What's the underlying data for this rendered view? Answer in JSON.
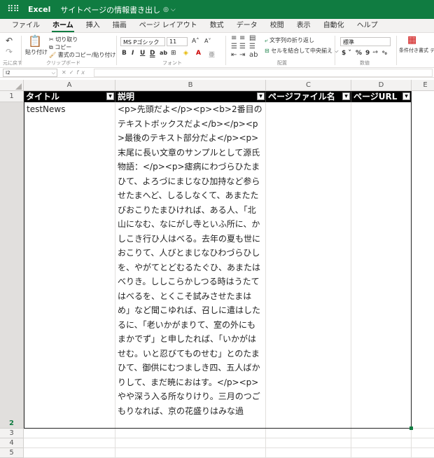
{
  "titlebar": {
    "app_name": "Excel",
    "doc_name": "サイトページの情報書き出し",
    "doc_suffix": "◎ ⌵"
  },
  "menu": {
    "tabs": [
      "ファイル",
      "ホーム",
      "挿入",
      "描画",
      "ページ レイアウト",
      "数式",
      "データ",
      "校閲",
      "表示",
      "自動化",
      "ヘルプ"
    ],
    "active": "ホーム"
  },
  "ribbon": {
    "undo_label": "元に戻す",
    "paste_label": "貼り付け",
    "cut_label": "切り取り",
    "copy_label": "コピー",
    "format_painter_label": "書式のコピー/貼り付け",
    "clipboard_group": "クリップボード",
    "font_name": "MS Pゴシック",
    "font_size": "11",
    "font_group": "フォント",
    "wrap_text_label": "文字列の折り返し",
    "merge_center_label": "セルを結合して中央揃え",
    "alignment_group": "配置",
    "number_format": "標準",
    "number_group": "数値",
    "conditional_format_label": "条件付き書式",
    "table_label": "テ"
  },
  "formula_bar": {
    "name_box": "I2",
    "formula": ""
  },
  "sheet": {
    "columns": [
      "A",
      "B",
      "C",
      "D",
      "E"
    ],
    "rows": [
      "1",
      "2",
      "3",
      "4",
      "5"
    ],
    "headers": [
      "タイトル",
      "説明",
      "ページファイル名",
      "ページURL"
    ],
    "row2": {
      "title": "testNews",
      "description": "<p>先頭だよ</p><p><b>2番目のテキストボックスだよ</b></p><p>最後のテキスト部分だよ</p><p>末尾に長い文章のサンプルとして源氏物語：</p><p>瘧病にわづらひたまひて、よろづにまじなひ加持など参らせたまへど、しるしなくて、あまたたびおこりたまひければ、ある人、「北山になむ、なにがし寺といふ所に、かしこき行ひ人はべる。去年の夏も世におこりて、人びとまじなひわづらひしを、やがてとどむるたぐひ、あまたはべりき。ししこらかしつる時はうたてはべるを、とくこそ試みさせたまはめ」など聞こゆれば、召しに遣はしたるに、「老いかがまりて、室の外にもまかでず」と申したれば、「いかがはせむ。いと忍びてものせむ」とのたまひて、御供にむつましき四、五人ばかりして、まだ暁におはす。</p><p>やや深う入る所なりけり。三月のつごもりなれば、京の花盛りはみな過",
      "page_file": "",
      "page_url": ""
    }
  }
}
